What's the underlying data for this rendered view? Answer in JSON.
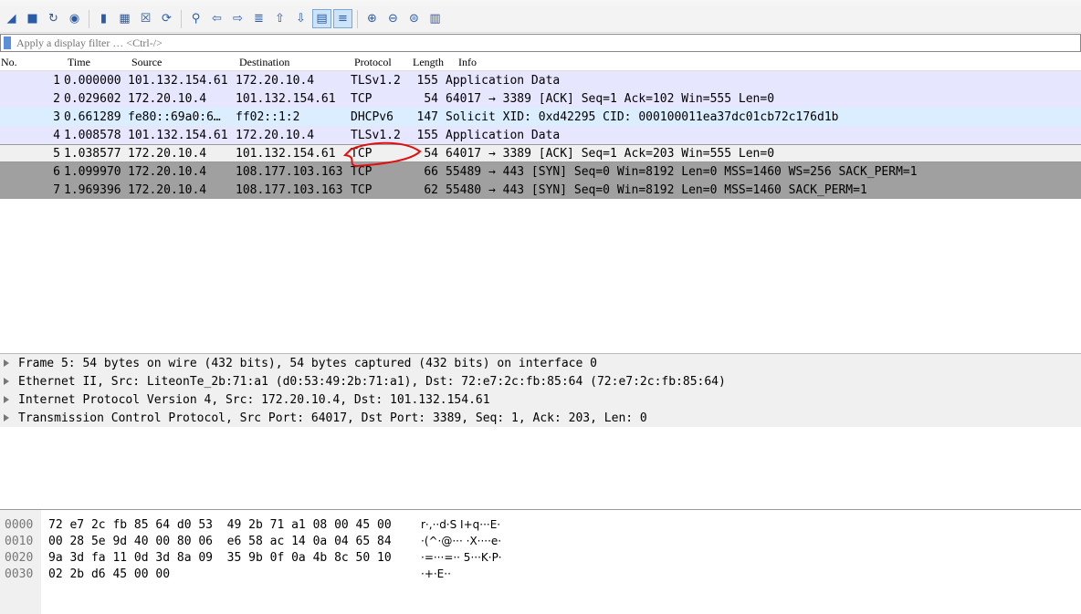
{
  "toolbar": {
    "icons": [
      "shark-fin-start-icon",
      "stop-icon",
      "restart-icon",
      "options-gear-icon",
      "open-folder-icon",
      "save-file-icon",
      "close-file-icon",
      "reload-icon",
      "find-icon",
      "go-back-icon",
      "go-forward-icon",
      "go-to-packet-icon",
      "first-packet-icon",
      "last-packet-icon",
      "autoscroll-icon",
      "colorize-icon",
      "zoom-in-icon",
      "zoom-out-icon",
      "zoom-normal-icon",
      "resize-columns-icon"
    ]
  },
  "filter": {
    "placeholder": "Apply a display filter … <Ctrl-/>",
    "value": ""
  },
  "packet_list": {
    "columns": [
      "No.",
      "Time",
      "Source",
      "Destination",
      "Protocol",
      "Length",
      "Info"
    ],
    "selected": 5,
    "rows": [
      {
        "no": "1",
        "time": "0.000000",
        "src": "101.132.154.61",
        "dst": "172.20.10.4",
        "proto": "TLSv1.2",
        "len": "155",
        "info": "Application Data",
        "color": "#e7e6ff"
      },
      {
        "no": "2",
        "time": "0.029602",
        "src": "172.20.10.4",
        "dst": "101.132.154.61",
        "proto": "TCP",
        "len": "54",
        "info": "64017 → 3389 [ACK] Seq=1 Ack=102 Win=555 Len=0",
        "color": "#e7e6ff"
      },
      {
        "no": "3",
        "time": "0.661289",
        "src": "fe80::69a0:6…",
        "dst": "ff02::1:2",
        "proto": "DHCPv6",
        "len": "147",
        "info": "Solicit XID: 0xd42295 CID: 000100011ea37dc01cb72c176d1b",
        "color": "#daeeff"
      },
      {
        "no": "4",
        "time": "1.008578",
        "src": "101.132.154.61",
        "dst": "172.20.10.4",
        "proto": "TLSv1.2",
        "len": "155",
        "info": "Application Data",
        "color": "#e7e6ff"
      },
      {
        "no": "5",
        "time": "1.038577",
        "src": "172.20.10.4",
        "dst": "101.132.154.61",
        "proto": "TCP",
        "len": "54",
        "info": "64017 → 3389 [ACK] Seq=1 Ack=203 Win=555 Len=0",
        "color": "#f0f0f0"
      },
      {
        "no": "6",
        "time": "1.099970",
        "src": "172.20.10.4",
        "dst": "108.177.103.163",
        "proto": "TCP",
        "len": "66",
        "info": "55489 → 443 [SYN] Seq=0 Win=8192 Len=0 MSS=1460 WS=256 SACK_PERM=1",
        "color": "#a0a0a0"
      },
      {
        "no": "7",
        "time": "1.969396",
        "src": "172.20.10.4",
        "dst": "108.177.103.163",
        "proto": "TCP",
        "len": "62",
        "info": "55480 → 443 [SYN] Seq=0 Win=8192 Len=0 MSS=1460 SACK_PERM=1",
        "color": "#a0a0a0"
      }
    ]
  },
  "details": [
    "Frame 5: 54 bytes on wire (432 bits), 54 bytes captured (432 bits) on interface 0",
    "Ethernet II, Src: LiteonTe_2b:71:a1 (d0:53:49:2b:71:a1), Dst: 72:e7:2c:fb:85:64 (72:e7:2c:fb:85:64)",
    "Internet Protocol Version 4, Src: 172.20.10.4, Dst: 101.132.154.61",
    "Transmission Control Protocol, Src Port: 64017, Dst Port: 3389, Seq: 1, Ack: 203, Len: 0"
  ],
  "bytes": [
    {
      "off": "0000",
      "hex": "72 e7 2c fb 85 64 d0 53  49 2b 71 a1 08 00 45 00",
      "ascii": "r·,··d·S I+q···E·"
    },
    {
      "off": "0010",
      "hex": "00 28 5e 9d 40 00 80 06  e6 58 ac 14 0a 04 65 84",
      "ascii": "·(^·@··· ·X····e·"
    },
    {
      "off": "0020",
      "hex": "9a 3d fa 11 0d 3d 8a 09  35 9b 0f 0a 4b 8c 50 10",
      "ascii": "·=···=·· 5···K·P·"
    },
    {
      "off": "0030",
      "hex": "02 2b d6 45 00 00",
      "ascii": "·+·E··"
    }
  ]
}
